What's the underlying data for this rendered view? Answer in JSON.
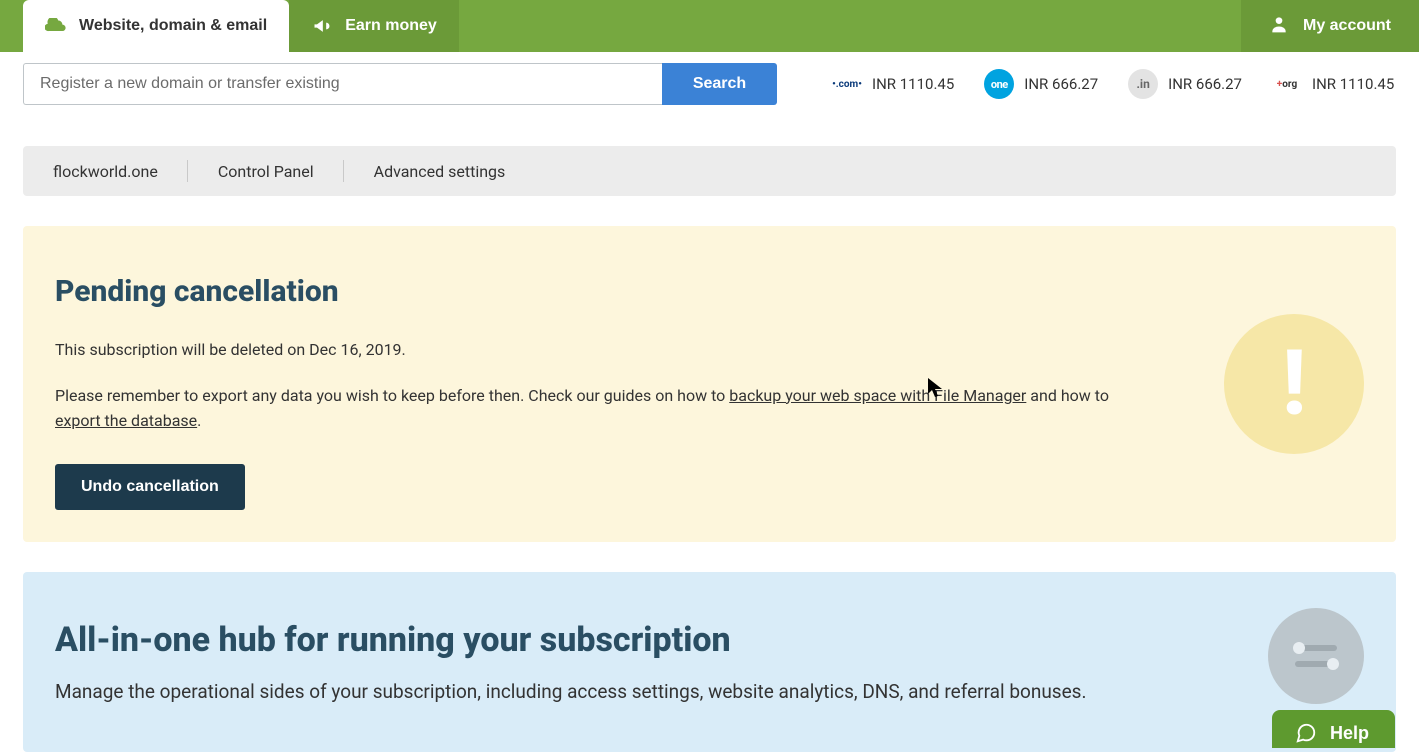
{
  "topbar": {
    "tab_active": "Website, domain & email",
    "tab_earn": "Earn money",
    "account": "My account"
  },
  "search": {
    "placeholder": "Register a new domain or transfer existing",
    "button": "Search"
  },
  "tlds": [
    {
      "label": ".com",
      "price": "INR 1110.45"
    },
    {
      "label": "one",
      "price": "INR 666.27"
    },
    {
      "label": ".in",
      "price": "INR 666.27"
    },
    {
      "label": "org",
      "price": "INR 1110.45"
    }
  ],
  "breadcrumb": {
    "domain": "flockworld.one",
    "cp": "Control Panel",
    "adv": "Advanced settings"
  },
  "alert": {
    "title": "Pending cancellation",
    "line1": "This subscription will be deleted on Dec 16, 2019.",
    "line2_pre": "Please remember to export any data you wish to keep before then. Check our guides on how to ",
    "link1": "backup your web space with File Manager",
    "line2_mid": " and how to ",
    "link2": "export the database",
    "line2_end": ".",
    "button": "Undo cancellation"
  },
  "hub": {
    "title": "All-in-one hub for running your subscription",
    "desc": "Manage the operational sides of your subscription, including access settings, website analytics, DNS, and referral bonuses."
  },
  "help": {
    "label": "Help"
  }
}
